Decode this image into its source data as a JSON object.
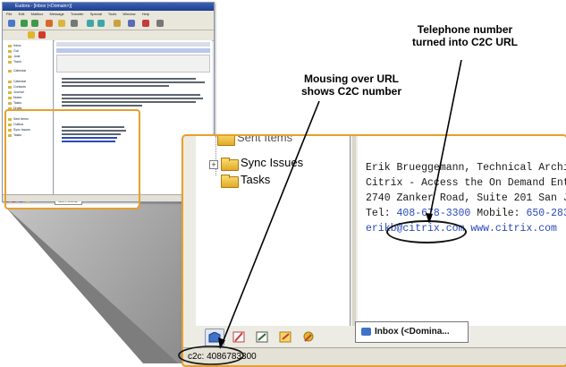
{
  "thumbnail": {
    "title": "Eudora - [Inbox (<Domain>)]",
    "menu": [
      "File",
      "Edit",
      "Mailbox",
      "Message",
      "Transfer",
      "Special",
      "Tools",
      "Window",
      "Help"
    ],
    "folders": [
      "Inbox",
      "Out",
      "Junk",
      "Trash",
      "Calendar",
      "Calendar",
      "Contacts",
      "Journal",
      "Notes",
      "Tasks",
      "Drafts",
      "Sent Items",
      "Outbox",
      "Sync Issues",
      "Tasks"
    ],
    "tab_label": "Inbox (<Domina..."
  },
  "zoom": {
    "tree": {
      "partial_item": "Sent Items",
      "sync_issues": "Sync Issues",
      "tasks": "Tasks"
    },
    "signature": {
      "line1": "Erik Brueggemann, Technical Archi",
      "line2": "Citrix - Access the On Demand Ent",
      "line3": "2740 Zanker Road, Suite 201 San J",
      "tel_label": "Tel: ",
      "tel_value": "408-678-3300",
      "mobile_label": " Mobile: ",
      "mobile_value": "650-283",
      "email": "erikb@citrix.com",
      "website": "www.citrix.com"
    },
    "inbox_tab": "Inbox (<Domina...",
    "status_text": "c2c: 4086783300"
  },
  "callouts": {
    "telephone_line1": "Telephone number",
    "telephone_line2": "turned into C2C URL",
    "mousing_line1": "Mousing over URL",
    "mousing_line2": "shows C2C number"
  },
  "colors": {
    "highlight": "#e8a02c",
    "link": "#2a49b8"
  }
}
